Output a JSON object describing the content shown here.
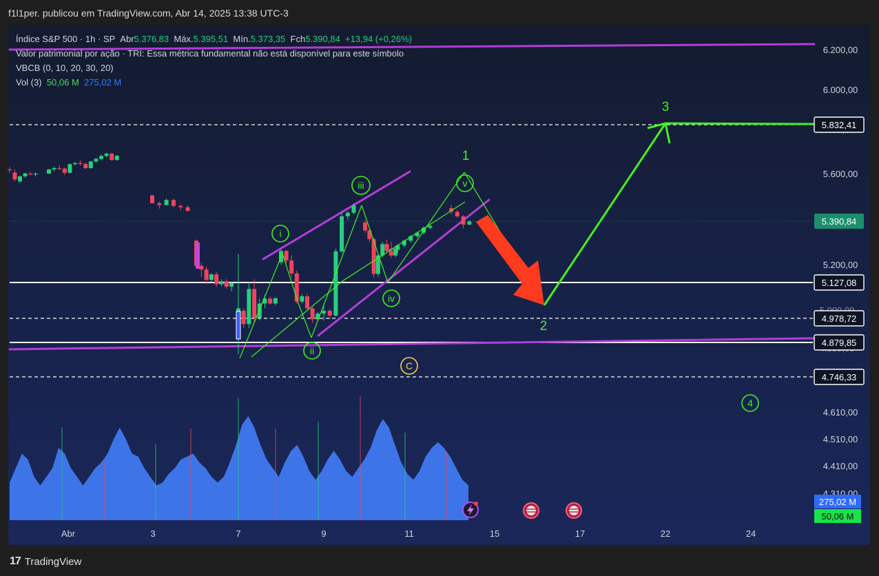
{
  "header": {
    "attribution": "f1l1per. publicou em TradingView.com, Abr 14, 2025 13:38 UTC-3"
  },
  "legend": {
    "symbol": "Índice S&P 500 · 1h · SP",
    "open_label": "Abr",
    "open_value": "5.376,83",
    "high_label": "Máx.",
    "high_value": "5.395,51",
    "low_label": "Mín.",
    "low_value": "5.373,35",
    "close_label": "Fch",
    "close_value": "5.390,84",
    "change": "+13,94 (+0,26%)",
    "line2": "Valor patrimonial por ação · TRI: Essa métrica fundamental não está disponível para este símbolo",
    "line3": "VBCB (0, 10, 20, 30, 20)",
    "vol_label": "Vol (3)",
    "vol_a": "50,06 M",
    "vol_b": "275,02 M"
  },
  "footer": {
    "brand": "TradingView",
    "logo": "17"
  },
  "colors": {
    "up": "#26d07c",
    "down": "#f0445e",
    "wave": "#44f020",
    "channel": "#b23ed6",
    "volume": "#3f78f0",
    "arrow": "#ff3b1f"
  },
  "chart_data": {
    "type": "candlestick",
    "title": "",
    "x_ticks": [
      "Abr",
      "3",
      "7",
      "9",
      "11",
      "15",
      "17",
      "22",
      "24"
    ],
    "y_ticks": [
      "6.200,00",
      "6.000,00",
      "5.600,00",
      "5.200,00",
      "4.610,00",
      "4.510,00",
      "4.410,00",
      "4.310,00"
    ],
    "price_labels": [
      {
        "text": "5.832,41",
        "style": "outline"
      },
      {
        "text": "5.390,84",
        "style": "current"
      },
      {
        "text": "5.127,08",
        "style": "outline"
      },
      {
        "text": "4.978,72",
        "style": "outline"
      },
      {
        "text": "4.879,85",
        "style": "outline"
      },
      {
        "text": "4.746,33",
        "style": "outline"
      }
    ],
    "volume_labels": [
      {
        "text": "275,02 M",
        "style": "blue"
      },
      {
        "text": "50,06 M",
        "style": "green"
      }
    ],
    "horizontal_lines": [
      {
        "price": 5832.41,
        "style": "dashed"
      },
      {
        "price": 5127.08,
        "style": "solid"
      },
      {
        "price": 4978.72,
        "style": "dashed"
      },
      {
        "price": 4879.85,
        "style": "solid"
      },
      {
        "price": 4746.33,
        "style": "dashed"
      }
    ],
    "wave_labels": {
      "one": "1",
      "two": "2",
      "three": "3",
      "four": "4",
      "i": "i",
      "ii": "ii",
      "iii": "iii",
      "iv": "iv",
      "v": "v",
      "c": "C"
    },
    "candles": [
      {
        "t": "Apr 1",
        "o": 5620,
        "h": 5632,
        "l": 5605,
        "c": 5617
      },
      {
        "t": "Apr 1",
        "o": 5605,
        "h": 5620,
        "l": 5566,
        "c": 5575
      },
      {
        "t": "Apr 1",
        "o": 5566,
        "h": 5592,
        "l": 5560,
        "c": 5588
      },
      {
        "t": "Apr 1",
        "o": 5588,
        "h": 5604,
        "l": 5582,
        "c": 5601
      },
      {
        "t": "Apr 1",
        "o": 5600,
        "h": 5610,
        "l": 5594,
        "c": 5596
      },
      {
        "t": "Apr 1",
        "o": 5596,
        "h": 5606,
        "l": 5588,
        "c": 5600
      },
      {
        "t": "Apr 2",
        "o": 5600,
        "h": 5622,
        "l": 5598,
        "c": 5620
      },
      {
        "t": "Apr 2",
        "o": 5620,
        "h": 5634,
        "l": 5612,
        "c": 5626
      },
      {
        "t": "Apr 2",
        "o": 5626,
        "h": 5640,
        "l": 5618,
        "c": 5624
      },
      {
        "t": "Apr 2",
        "o": 5624,
        "h": 5628,
        "l": 5594,
        "c": 5604
      },
      {
        "t": "Apr 2",
        "o": 5604,
        "h": 5648,
        "l": 5600,
        "c": 5645
      },
      {
        "t": "Apr 2",
        "o": 5645,
        "h": 5656,
        "l": 5638,
        "c": 5650
      },
      {
        "t": "Apr 2",
        "o": 5650,
        "h": 5664,
        "l": 5638,
        "c": 5646
      },
      {
        "t": "Apr 2",
        "o": 5646,
        "h": 5652,
        "l": 5622,
        "c": 5626
      },
      {
        "t": "Apr 2",
        "o": 5626,
        "h": 5660,
        "l": 5624,
        "c": 5658
      },
      {
        "t": "Apr 2",
        "o": 5658,
        "h": 5675,
        "l": 5650,
        "c": 5670
      },
      {
        "t": "Apr 2",
        "o": 5670,
        "h": 5690,
        "l": 5664,
        "c": 5684
      },
      {
        "t": "Apr 2",
        "o": 5684,
        "h": 5700,
        "l": 5676,
        "c": 5695
      },
      {
        "t": "Apr 2",
        "o": 5695,
        "h": 5700,
        "l": 5660,
        "c": 5665
      },
      {
        "t": "Apr 2",
        "o": 5665,
        "h": 5688,
        "l": 5660,
        "c": 5685
      },
      {
        "t": "Apr 3",
        "o": 5504,
        "h": 5508,
        "l": 5468,
        "c": 5470
      },
      {
        "t": "Apr 3",
        "o": 5470,
        "h": 5478,
        "l": 5446,
        "c": 5462
      },
      {
        "t": "Apr 3",
        "o": 5462,
        "h": 5490,
        "l": 5458,
        "c": 5484
      },
      {
        "t": "Apr 3",
        "o": 5484,
        "h": 5490,
        "l": 5452,
        "c": 5458
      },
      {
        "t": "Apr 3",
        "o": 5458,
        "h": 5466,
        "l": 5440,
        "c": 5452
      },
      {
        "t": "Apr 3",
        "o": 5452,
        "h": 5460,
        "l": 5432,
        "c": 5436
      },
      {
        "t": "Apr 4",
        "o": 5305,
        "h": 5310,
        "l": 5190,
        "c": 5195
      },
      {
        "t": "Apr 4",
        "o": 5195,
        "h": 5208,
        "l": 5150,
        "c": 5180
      },
      {
        "t": "Apr 4",
        "o": 5180,
        "h": 5192,
        "l": 5120,
        "c": 5138
      },
      {
        "t": "Apr 4",
        "o": 5138,
        "h": 5165,
        "l": 5130,
        "c": 5160
      },
      {
        "t": "Apr 4",
        "o": 5160,
        "h": 5170,
        "l": 5110,
        "c": 5120
      },
      {
        "t": "Apr 4",
        "o": 5120,
        "h": 5140,
        "l": 5112,
        "c": 5132
      },
      {
        "t": "Apr 4",
        "o": 5132,
        "h": 5140,
        "l": 5102,
        "c": 5110
      },
      {
        "t": "Apr 4",
        "o": 5110,
        "h": 5130,
        "l": 5090,
        "c": 5124
      },
      {
        "t": "Apr 7",
        "o": 4918,
        "h": 5246,
        "l": 4835,
        "c": 5020
      },
      {
        "t": "Apr 7",
        "o": 5010,
        "h": 5020,
        "l": 4940,
        "c": 4955
      },
      {
        "t": "Apr 7",
        "o": 4955,
        "h": 5128,
        "l": 4938,
        "c": 5100
      },
      {
        "t": "Apr 7",
        "o": 5100,
        "h": 5140,
        "l": 4960,
        "c": 4980
      },
      {
        "t": "Apr 7",
        "o": 4980,
        "h": 5060,
        "l": 4970,
        "c": 5040
      },
      {
        "t": "Apr 7",
        "o": 5040,
        "h": 5075,
        "l": 5020,
        "c": 5060
      },
      {
        "t": "Apr 7",
        "o": 5060,
        "h": 5070,
        "l": 5035,
        "c": 5040
      },
      {
        "t": "Apr 7",
        "o": 5040,
        "h": 5066,
        "l": 5032,
        "c": 5062
      },
      {
        "t": "Apr 8",
        "o": 5210,
        "h": 5270,
        "l": 5200,
        "c": 5260
      },
      {
        "t": "Apr 8",
        "o": 5260,
        "h": 5265,
        "l": 5205,
        "c": 5218
      },
      {
        "t": "Apr 8",
        "o": 5218,
        "h": 5240,
        "l": 5150,
        "c": 5164
      },
      {
        "t": "Apr 8",
        "o": 5164,
        "h": 5175,
        "l": 5040,
        "c": 5048
      },
      {
        "t": "Apr 8",
        "o": 5048,
        "h": 5080,
        "l": 5040,
        "c": 5070
      },
      {
        "t": "Apr 8",
        "o": 5070,
        "h": 5080,
        "l": 5010,
        "c": 5020
      },
      {
        "t": "Apr 8",
        "o": 5020,
        "h": 5030,
        "l": 4960,
        "c": 4975
      },
      {
        "t": "Apr 8",
        "o": 4975,
        "h": 5005,
        "l": 4970,
        "c": 4998
      },
      {
        "t": "Apr 9",
        "o": 4998,
        "h": 5030,
        "l": 4970,
        "c": 5010
      },
      {
        "t": "Apr 9",
        "o": 5010,
        "h": 5018,
        "l": 4975,
        "c": 4990
      },
      {
        "t": "Apr 9",
        "o": 4990,
        "h": 5270,
        "l": 4985,
        "c": 5258
      },
      {
        "t": "Apr 9",
        "o": 5258,
        "h": 5430,
        "l": 5250,
        "c": 5412
      },
      {
        "t": "Apr 9",
        "o": 5412,
        "h": 5435,
        "l": 5395,
        "c": 5428
      },
      {
        "t": "Apr 9",
        "o": 5428,
        "h": 5470,
        "l": 5420,
        "c": 5460
      },
      {
        "t": "Apr 10",
        "o": 5385,
        "h": 5395,
        "l": 5340,
        "c": 5350
      },
      {
        "t": "Apr 10",
        "o": 5350,
        "h": 5360,
        "l": 5300,
        "c": 5312
      },
      {
        "t": "Apr 10",
        "o": 5312,
        "h": 5320,
        "l": 5148,
        "c": 5162
      },
      {
        "t": "Apr 10",
        "o": 5162,
        "h": 5250,
        "l": 5150,
        "c": 5240
      },
      {
        "t": "Apr 10",
        "o": 5240,
        "h": 5300,
        "l": 5230,
        "c": 5290
      },
      {
        "t": "Apr 10",
        "o": 5290,
        "h": 5310,
        "l": 5250,
        "c": 5260
      },
      {
        "t": "Apr 10",
        "o": 5260,
        "h": 5272,
        "l": 5230,
        "c": 5240
      },
      {
        "t": "Apr 10",
        "o": 5240,
        "h": 5282,
        "l": 5232,
        "c": 5270
      },
      {
        "t": "Apr 11",
        "o": 5270,
        "h": 5300,
        "l": 5258,
        "c": 5265
      },
      {
        "t": "Apr 11",
        "o": 5265,
        "h": 5290,
        "l": 5250,
        "c": 5284
      },
      {
        "t": "Apr 11",
        "o": 5284,
        "h": 5310,
        "l": 5275,
        "c": 5305
      },
      {
        "t": "Apr 11",
        "o": 5305,
        "h": 5330,
        "l": 5295,
        "c": 5325
      },
      {
        "t": "Apr 11",
        "o": 5325,
        "h": 5345,
        "l": 5318,
        "c": 5340
      },
      {
        "t": "Apr 11",
        "o": 5340,
        "h": 5368,
        "l": 5332,
        "c": 5362
      },
      {
        "t": "Apr 11",
        "o": 5362,
        "h": 5380,
        "l": 5355,
        "c": 5370
      },
      {
        "t": "Apr 14",
        "o": 5448,
        "h": 5462,
        "l": 5420,
        "c": 5432
      },
      {
        "t": "Apr 14",
        "o": 5432,
        "h": 5440,
        "l": 5405,
        "c": 5412
      },
      {
        "t": "Apr 14",
        "o": 5412,
        "h": 5418,
        "l": 5360,
        "c": 5376
      },
      {
        "t": "Apr 14",
        "o": 5376,
        "h": 5395,
        "l": 5373,
        "c": 5390
      }
    ],
    "volume_millions": [
      130,
      180,
      230,
      210,
      150,
      120,
      150,
      180,
      250,
      230,
      180,
      150,
      120,
      150,
      180,
      200,
      230,
      280,
      320,
      280,
      230,
      220,
      180,
      150,
      120,
      130,
      160,
      180,
      210,
      220,
      230,
      200,
      180,
      150,
      130,
      150,
      200,
      260,
      330,
      360,
      320,
      260,
      210,
      180,
      150,
      200,
      240,
      260,
      220,
      170,
      140,
      170,
      210,
      240,
      210,
      170,
      150,
      180,
      210,
      250,
      310,
      350,
      320,
      260,
      200,
      160,
      140,
      170,
      220,
      250,
      270,
      250,
      220,
      180,
      140,
      120
    ]
  }
}
